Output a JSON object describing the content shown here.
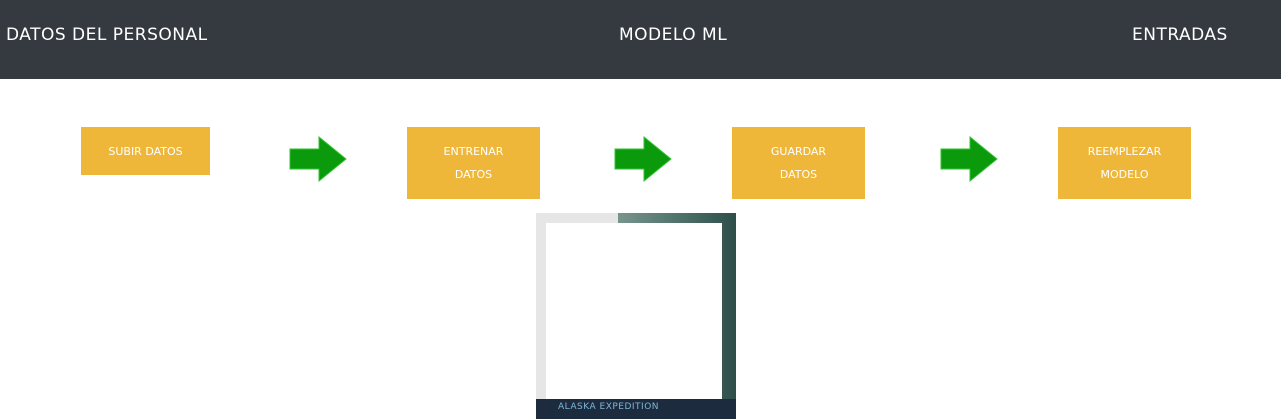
{
  "navbar": {
    "items": [
      {
        "label": "DATOS DEL PERSONAL"
      },
      {
        "label": "MODELO ML"
      },
      {
        "label": "ENTRADAS"
      }
    ]
  },
  "pipeline": {
    "steps": [
      {
        "label_line1": "SUBIR DATOS",
        "label_line2": ""
      },
      {
        "label_line1": "ENTRENAR",
        "label_line2": "DATOS"
      },
      {
        "label_line1": "GUARDAR",
        "label_line2": "DATOS"
      },
      {
        "label_line1": "REEMPLEZAR",
        "label_line2": "MODELO"
      }
    ],
    "arrow_icon": "arrow-right-icon",
    "colors": {
      "step_bg": "#eeb73a",
      "arrow": "#0b9a0b",
      "navbar_bg": "#343a40"
    }
  },
  "camera": {
    "shirt_text": "ALASKA EXPEDITION"
  }
}
